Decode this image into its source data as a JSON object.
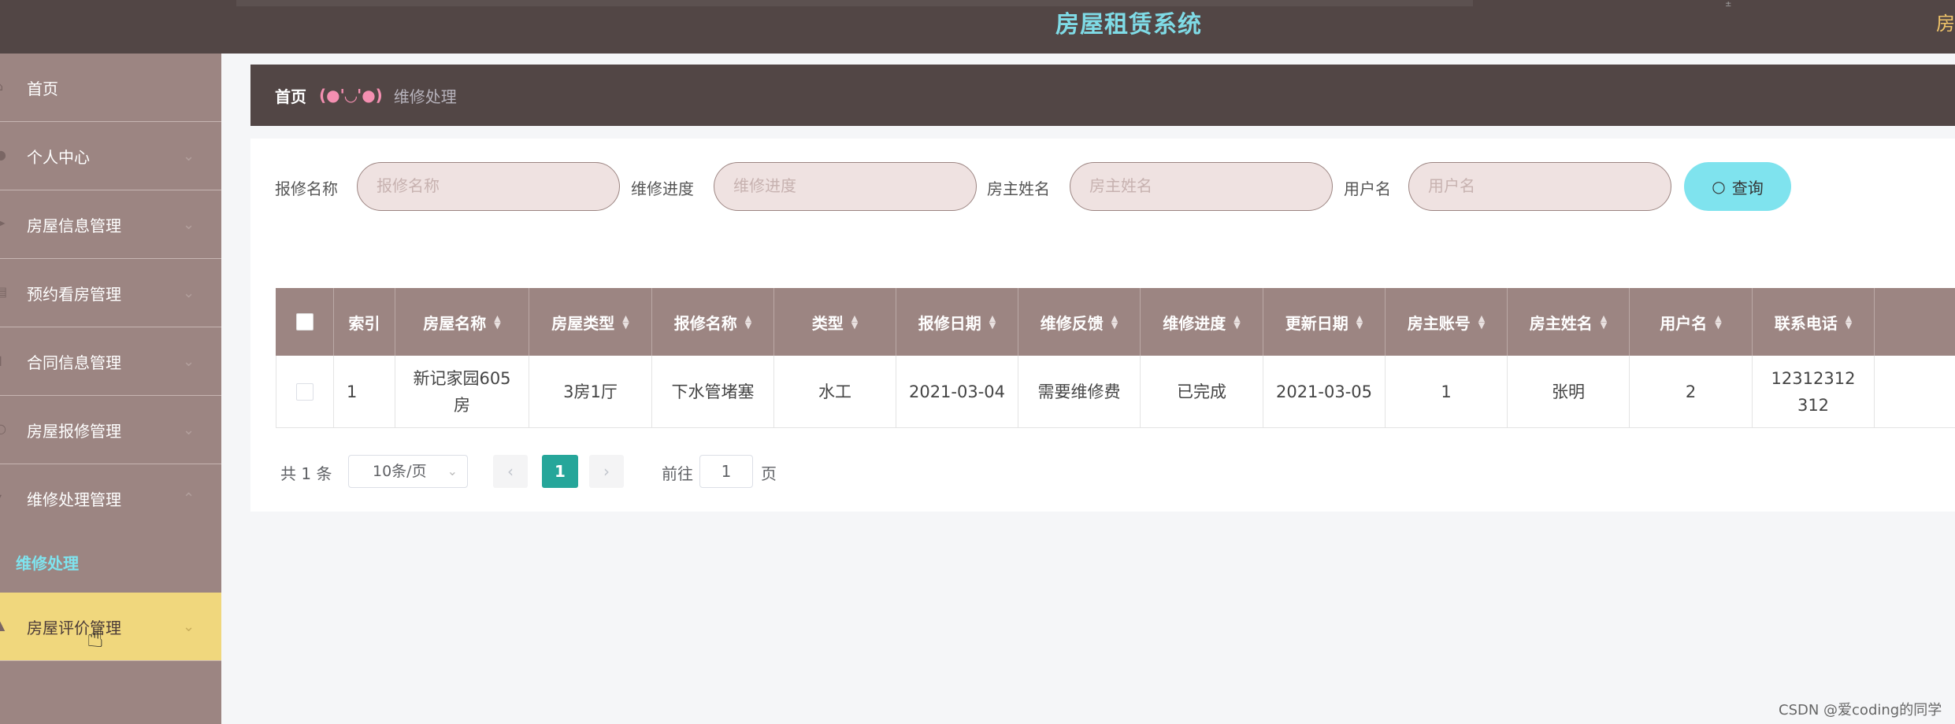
{
  "header": {
    "title": "房屋租赁系统",
    "right_fragment": "房",
    "tiny": "±"
  },
  "sidebar": {
    "items": [
      {
        "label": "首页",
        "icon": "home-icon",
        "arrow": ""
      },
      {
        "label": "个人中心",
        "icon": "user-icon",
        "arrow": "⌄"
      },
      {
        "label": "房屋信息管理",
        "icon": "send-icon",
        "arrow": "⌄"
      },
      {
        "label": "预约看房管理",
        "icon": "doc-icon",
        "arrow": "⌄"
      },
      {
        "label": "合同信息管理",
        "icon": "chart-icon",
        "arrow": "⌄"
      },
      {
        "label": "房屋报修管理",
        "icon": "bulb-icon",
        "arrow": "⌄"
      },
      {
        "label": "维修处理管理",
        "icon": "cart-icon",
        "arrow": "⌃"
      },
      {
        "label": "房屋评价管理",
        "icon": "bank-icon",
        "arrow": "⌄"
      }
    ],
    "sub_item": "维修处理"
  },
  "breadcrumb": {
    "home": "首页",
    "face": "(●'◡'●)",
    "current": "维修处理"
  },
  "search": {
    "fields": [
      {
        "label": "报修名称",
        "placeholder": "报修名称"
      },
      {
        "label": "维修进度",
        "placeholder": "维修进度"
      },
      {
        "label": "房主姓名",
        "placeholder": "房主姓名"
      },
      {
        "label": "用户名",
        "placeholder": "用户名"
      }
    ],
    "button": "查询"
  },
  "table": {
    "headers": [
      "索引",
      "房屋名称",
      "房屋类型",
      "报修名称",
      "类型",
      "报修日期",
      "维修反馈",
      "维修进度",
      "更新日期",
      "房主账号",
      "房主姓名",
      "用户名",
      "联系电话"
    ],
    "rows": [
      [
        "1",
        "新记家园605房",
        "3房1厅",
        "下水管堵塞",
        "水工",
        "2021-03-04",
        "需要维修费",
        "已完成",
        "2021-03-05",
        "1",
        "张明",
        "2",
        "12312312312"
      ]
    ]
  },
  "pagination": {
    "total": "共 1 条",
    "page_size": "10条/页",
    "current_page": "1",
    "goto_label": "前往",
    "goto_value": "1",
    "unit": "页"
  },
  "watermark": "CSDN @爱coding的同学",
  "colors": {
    "topbar": "#524645",
    "sidebar": "#9c8582",
    "accent": "#7fe3ee",
    "active": "#f0d77d",
    "page_active": "#26a69a"
  }
}
